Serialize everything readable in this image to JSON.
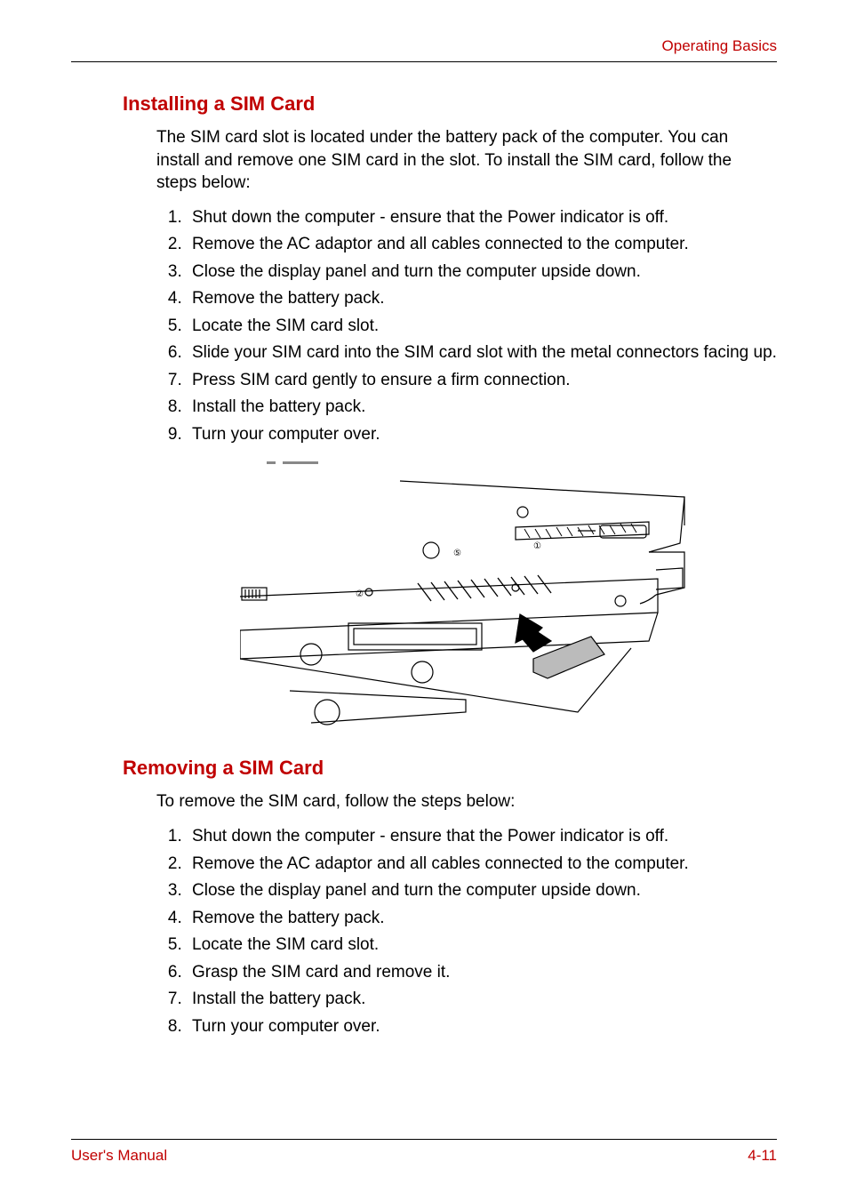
{
  "header": {
    "right": "Operating Basics"
  },
  "section1": {
    "title": "Installing a SIM Card",
    "intro": "The SIM card slot is located under the battery pack of the computer. You can install and remove one SIM card in the slot. To install the SIM card, follow the steps below:",
    "steps": [
      "Shut down the computer - ensure that the Power indicator is off.",
      "Remove the AC adaptor and all cables connected to the computer.",
      "Close the display panel and turn the computer upside down.",
      "Remove the battery pack.",
      "Locate the SIM card slot.",
      "Slide your SIM card into the SIM card slot with the metal connectors facing up.",
      "Press SIM card gently to ensure a firm connection.",
      "Install the battery pack.",
      "Turn your computer over."
    ]
  },
  "section2": {
    "title": "Removing a SIM Card",
    "intro": "To remove the SIM card, follow the steps below:",
    "steps": [
      "Shut down the computer - ensure that the Power indicator is off.",
      "Remove the AC adaptor and all cables connected to the computer.",
      "Close the display panel and turn the computer upside down.",
      "Remove the battery pack.",
      "Locate the SIM card slot.",
      "Grasp the SIM card and remove it.",
      "Install the battery pack.",
      "Turn your computer over."
    ]
  },
  "footer": {
    "left": "User's Manual",
    "right": "4-11"
  }
}
